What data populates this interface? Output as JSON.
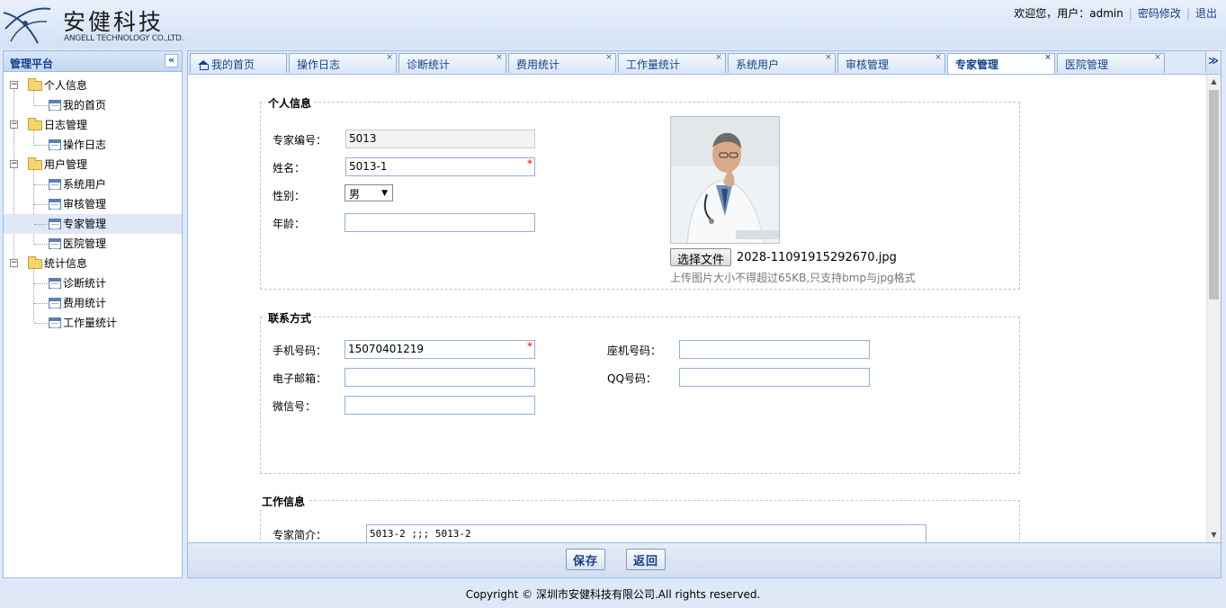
{
  "header": {
    "logo_cn": "安健科技",
    "logo_en": "ANGELL TECHNOLOGY CO.,LTD.",
    "welcome": "欢迎您，用户：admin",
    "change_password": "密码修改",
    "logout": "退出"
  },
  "sidebar": {
    "title": "管理平台",
    "collapse_icon": "«",
    "groups": [
      {
        "label": "个人信息",
        "expander": "−",
        "items": [
          {
            "label": "我的首页"
          }
        ]
      },
      {
        "label": "日志管理",
        "expander": "−",
        "items": [
          {
            "label": "操作日志"
          }
        ]
      },
      {
        "label": "用户管理",
        "expander": "−",
        "items": [
          {
            "label": "系统用户"
          },
          {
            "label": "审核管理"
          },
          {
            "label": "专家管理"
          },
          {
            "label": "医院管理"
          }
        ]
      },
      {
        "label": "统计信息",
        "expander": "−",
        "items": [
          {
            "label": "诊断统计"
          },
          {
            "label": "费用统计"
          },
          {
            "label": "工作量统计"
          }
        ]
      }
    ],
    "selected_item": "专家管理"
  },
  "tabs": {
    "items": [
      {
        "label": "我的首页"
      },
      {
        "label": "操作日志"
      },
      {
        "label": "诊断统计"
      },
      {
        "label": "费用统计"
      },
      {
        "label": "工作量统计"
      },
      {
        "label": "系统用户"
      },
      {
        "label": "审核管理"
      },
      {
        "label": "专家管理"
      },
      {
        "label": "医院管理"
      }
    ],
    "active": "专家管理",
    "close_glyph": "×",
    "more_glyph": "≫"
  },
  "form": {
    "personal": {
      "legend": "个人信息",
      "expert_id_label": "专家编号：",
      "expert_id_value": "5013",
      "name_label": "姓名：",
      "name_value": "5013-1",
      "gender_label": "性别：",
      "gender_value": "男",
      "age_label": "年龄：",
      "age_value": "",
      "required_mark": "*",
      "choose_file": "选择文件",
      "file_name": "2028-11091915292670.jpg",
      "upload_hint": "上传图片大小不得超过65KB,只支持bmp与jpg格式"
    },
    "contact": {
      "legend": "联系方式",
      "mobile_label": "手机号码：",
      "mobile_value": "15070401219",
      "landline_label": "座机号码：",
      "landline_value": "",
      "email_label": "电子邮箱：",
      "email_value": "",
      "qq_label": "QQ号码：",
      "qq_value": "",
      "wechat_label": "微信号：",
      "wechat_value": ""
    },
    "work": {
      "legend": "工作信息",
      "intro_label": "专家简介：",
      "intro_value": "5013-2 ;;; 5013-2"
    }
  },
  "actions": {
    "save": "保存",
    "back": "返回"
  },
  "footer": "Copyright © 深圳市安健科技有限公司.All rights reserved.",
  "colors": {
    "accent": "#15428b",
    "border": "#99bbe8",
    "background": "#dfe8f6",
    "required": "#ee0000"
  }
}
